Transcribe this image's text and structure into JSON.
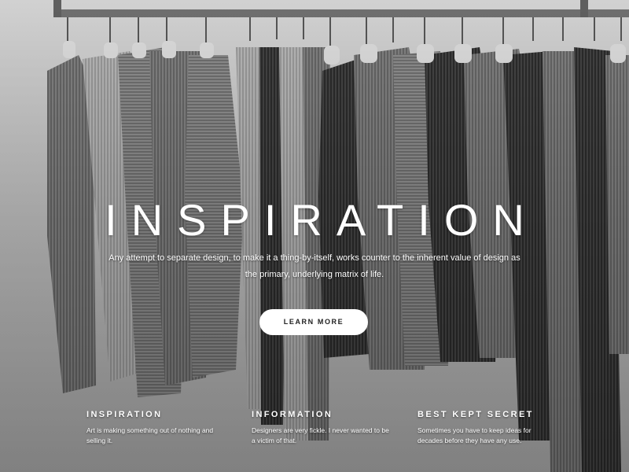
{
  "hero": {
    "title": "INSPIRATION",
    "subtitle": "Any attempt to separate design, to make it a thing-by-itself, works counter to the inherent value of design as the primary, underlying matrix of life.",
    "cta_label": "LEARN MORE"
  },
  "features": [
    {
      "heading": "INSPIRATION",
      "text": "Art is making something out of nothing and selling it."
    },
    {
      "heading": "INFORMATION",
      "text": "Designers are very fickle. I never wanted to be a victim of that."
    },
    {
      "heading": "BEST KEPT SECRET",
      "text": "Sometimes you have to keep ideas for decades before they have any use."
    }
  ],
  "colors": {
    "text": "#ffffff",
    "button_bg": "#ffffff",
    "button_text": "#222222"
  }
}
